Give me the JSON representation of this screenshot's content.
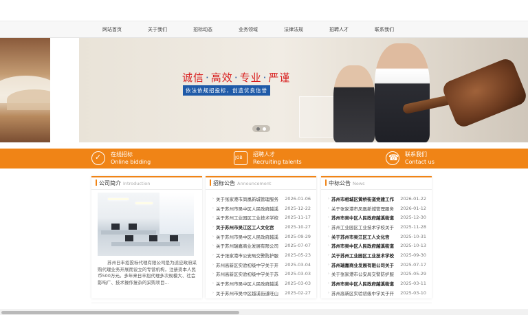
{
  "nav": {
    "items": [
      {
        "label": "网站首页"
      },
      {
        "label": "关于我们"
      },
      {
        "label": "招标动态"
      },
      {
        "label": "业务领域"
      },
      {
        "label": "法律法规"
      },
      {
        "label": "招聘人才"
      },
      {
        "label": "联系我们"
      }
    ]
  },
  "banner": {
    "slogan_words": [
      "诚信",
      "高效",
      "专业",
      "严谨"
    ],
    "subslogan": "依法依规招投标，创造优良信誉",
    "slide_count": 2,
    "active_slide": 1
  },
  "quicklinks": [
    {
      "title": "在线招标",
      "subtitle": "Online bidding",
      "icon": "checkmark-circle-icon"
    },
    {
      "title": "招聘人才",
      "subtitle": "Recruiting talents",
      "icon": "job-icon"
    },
    {
      "title": "联系我们",
      "subtitle": "Contact us",
      "icon": "headset-phone-icon"
    }
  ],
  "about": {
    "title": "公司简介",
    "title_en": "Introduction",
    "text": "苏州日丰招投标代理有限公司是为适应政府采购代理业务开展而设立的专营机构，注册资本人民币500万元。多年来日丰招代理多次规模大、社会影响广、技术操作复杂的采购项目..."
  },
  "announcements": {
    "title": "招标公告",
    "title_en": "Announcement",
    "items": [
      {
        "title": "关于张家港市凤凰新城管理服务",
        "date": "2026-01-06",
        "bold": false
      },
      {
        "title": "关于苏州市吴中区人民政府越溪",
        "date": "2025-12-22",
        "bold": false
      },
      {
        "title": "关于苏州工业园区工业技术学校",
        "date": "2025-11-17",
        "bold": false
      },
      {
        "title": "关于苏州市吴江区工人文化宫",
        "date": "2025-10-27",
        "bold": true
      },
      {
        "title": "关于苏州市吴中区人民政府越溪",
        "date": "2025-09-29",
        "bold": false
      },
      {
        "title": "关于苏州瑞嘉商业发展有限公司",
        "date": "2025-07-07",
        "bold": false
      },
      {
        "title": "关于张家港市公安局交警防护服",
        "date": "2025-05-23",
        "bold": false
      },
      {
        "title": "苏州高新区实验初级中学关于开",
        "date": "2025-03-04",
        "bold": false
      },
      {
        "title": "苏州高新区实验初级中学关于苏",
        "date": "2025-03-03",
        "bold": false
      },
      {
        "title": "关于苏州市吴中区人民政府越溪",
        "date": "2025-03-03",
        "bold": false
      },
      {
        "title": "关于苏州市吴中区越溪街道旺山",
        "date": "2025-02-27",
        "bold": false
      }
    ]
  },
  "awards": {
    "title": "中标公告",
    "title_en": "News",
    "items": [
      {
        "title": "苏州市相城区黄桥街道党建工作",
        "date": "2026-01-22",
        "bold": true
      },
      {
        "title": "关于张家港市凤凰新城管理服务",
        "date": "2026-01-12",
        "bold": false
      },
      {
        "title": "苏州市吴中区人民政府越溪街道",
        "date": "2025-12-30",
        "bold": true
      },
      {
        "title": "苏州工业园区工业技术学校关于",
        "date": "2025-11-28",
        "bold": false
      },
      {
        "title": "关于苏州市吴江区工人文化宫",
        "date": "2025-10-31",
        "bold": true
      },
      {
        "title": "苏州市吴中区人民政府越溪街道",
        "date": "2025-10-13",
        "bold": true
      },
      {
        "title": "关于苏州工业园区工业技术学校",
        "date": "2025-09-30",
        "bold": true
      },
      {
        "title": "苏州瑞嘉商业发展有限公司关于",
        "date": "2025-07-17",
        "bold": true
      },
      {
        "title": "关于张家港市公安局交警防护服",
        "date": "2025-05-29",
        "bold": false
      },
      {
        "title": "苏州市吴中区人民政府越溪街道",
        "date": "2025-03-11",
        "bold": true
      },
      {
        "title": "苏州高新区实验初级中学关于开",
        "date": "2025-03-10",
        "bold": false
      }
    ]
  },
  "colors": {
    "accent": "#f08416",
    "banner_blue": "#1f5aa8",
    "slogan_red": "#d81e1e"
  }
}
